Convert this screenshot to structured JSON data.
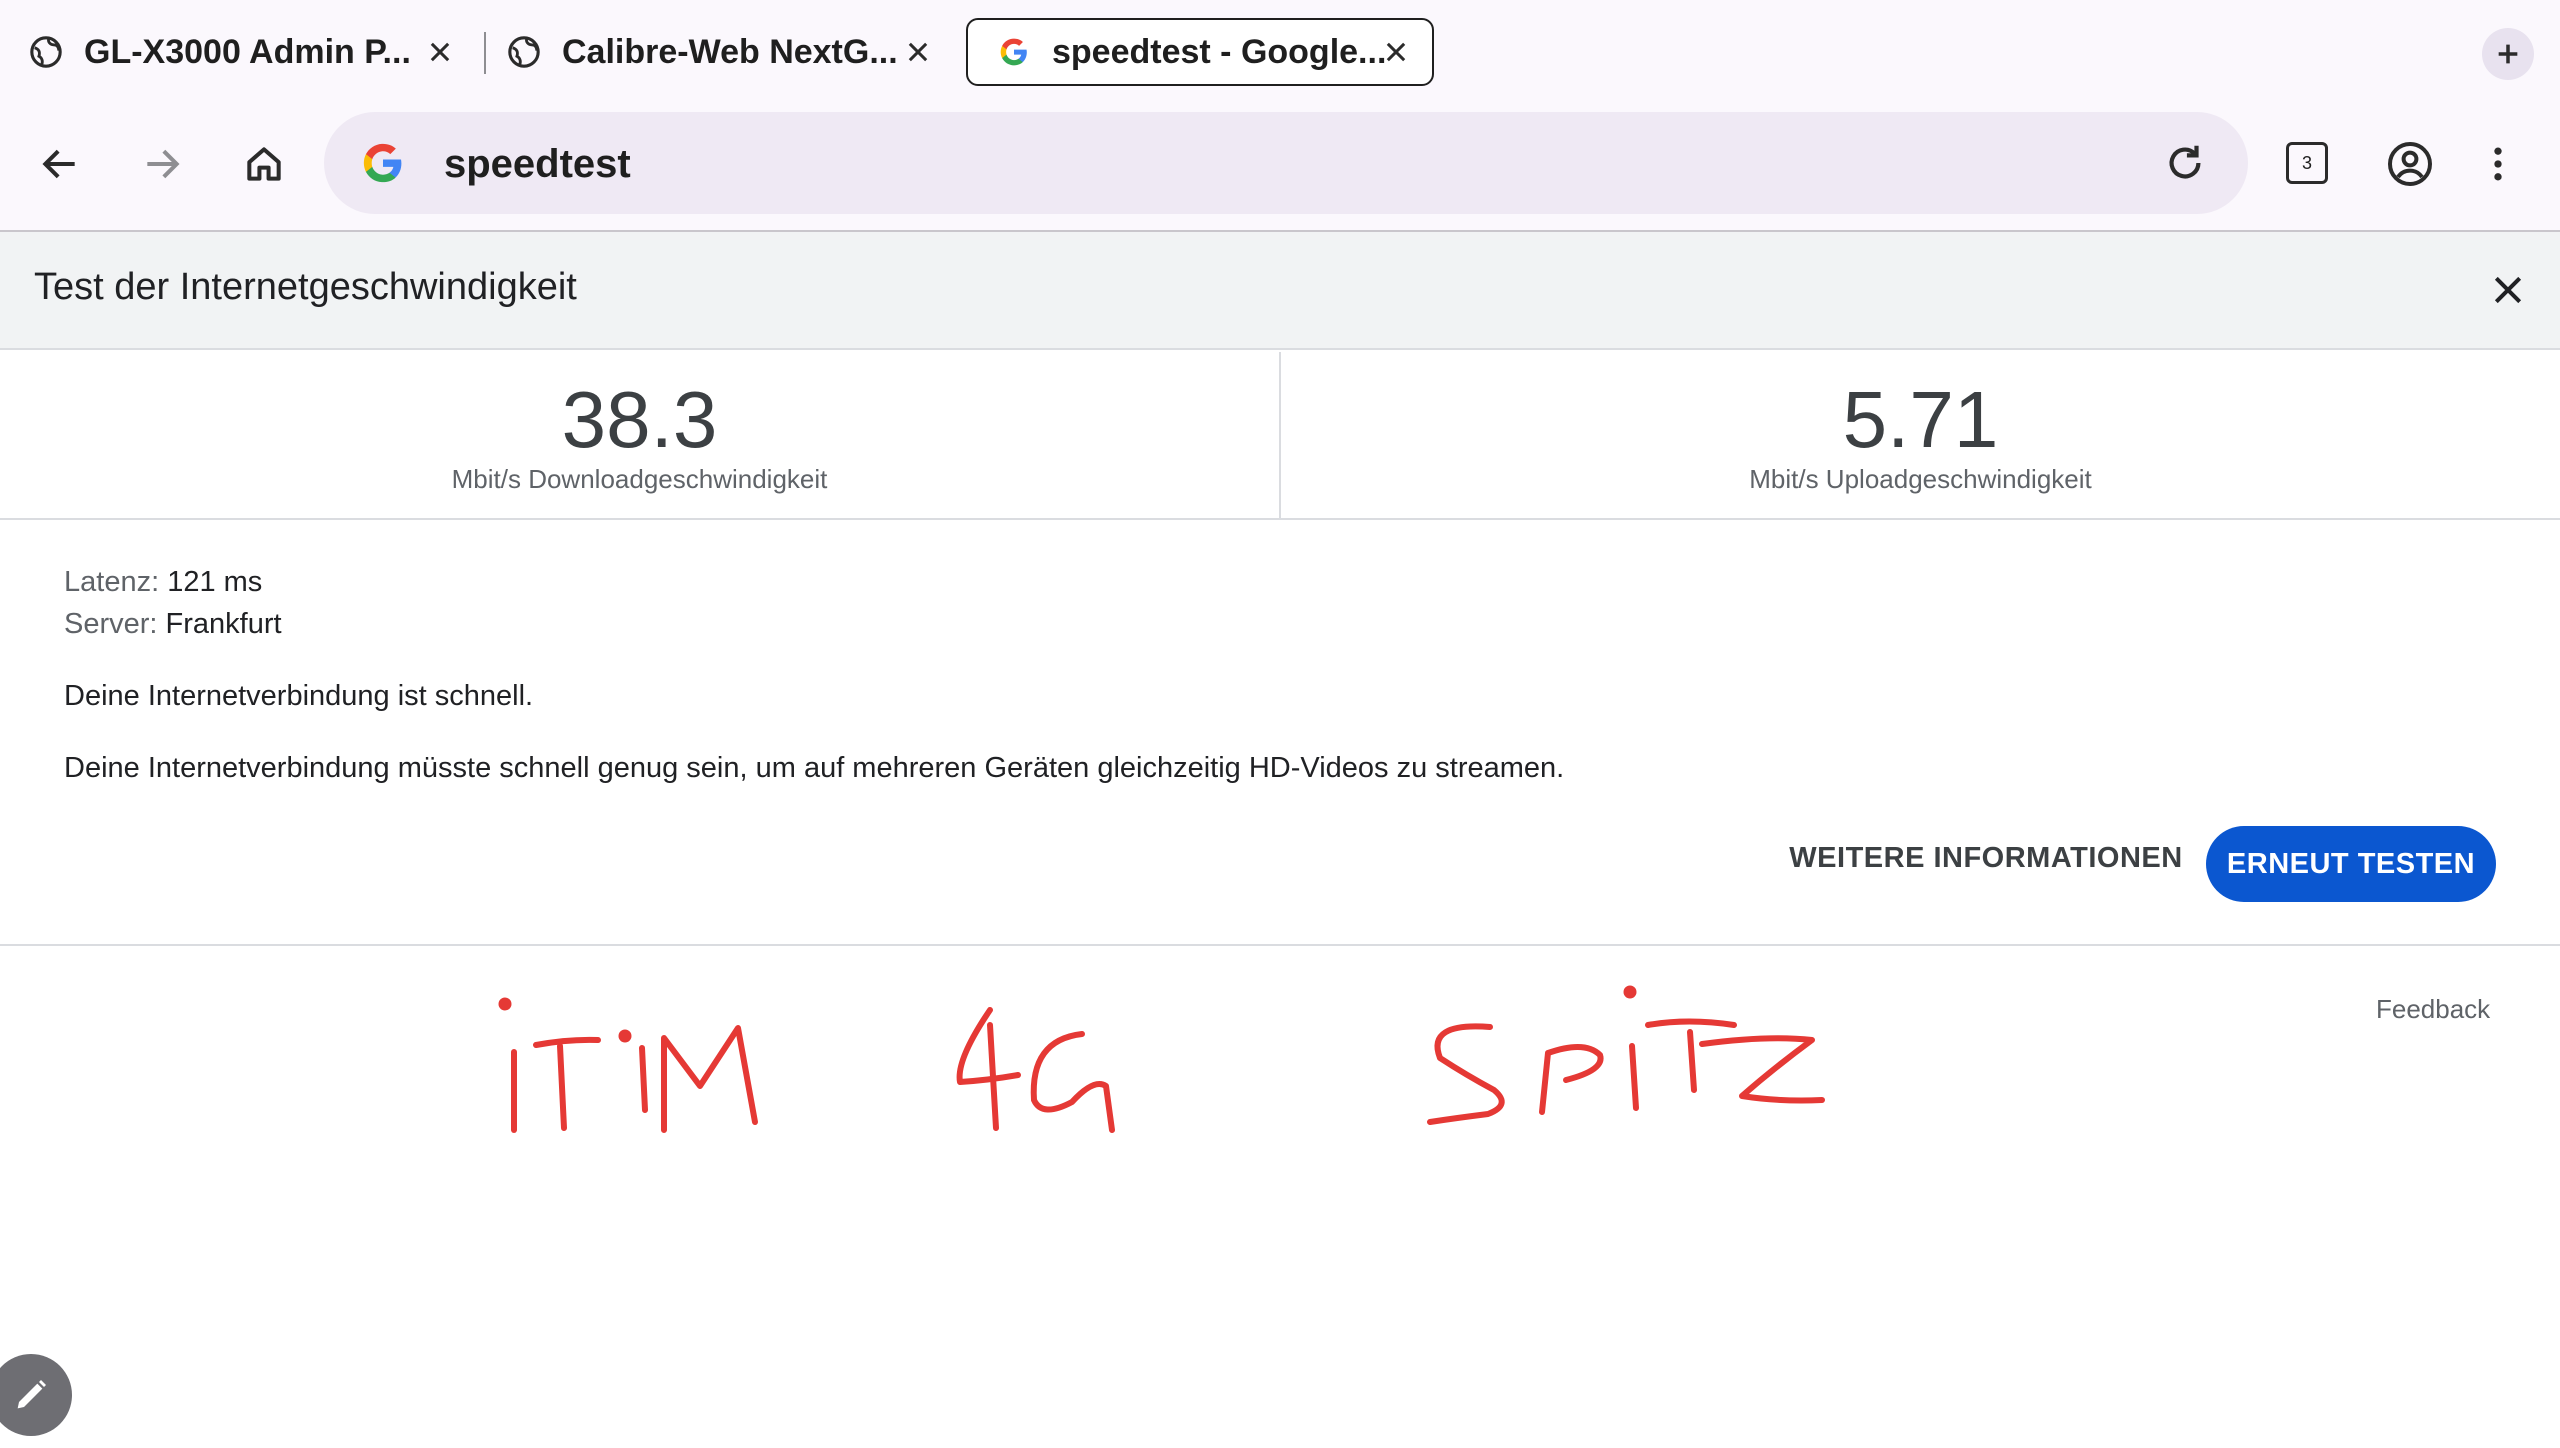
{
  "tabs": [
    {
      "title": "GL-X3000 Admin P...",
      "icon": "globe-icon"
    },
    {
      "title": "Calibre-Web NextG...",
      "icon": "globe-icon"
    },
    {
      "title": "speedtest - Google...",
      "icon": "google-icon",
      "active": true
    }
  ],
  "toolbar": {
    "omnibox_text": "speedtest",
    "tab_count": "3"
  },
  "speedtest": {
    "title": "Test der Internetgeschwindigkeit",
    "download": {
      "value": "38.3",
      "label": "Mbit/s Downloadgeschwindigkeit"
    },
    "upload": {
      "value": "5.71",
      "label": "Mbit/s Uploadgeschwindigkeit"
    },
    "latency_key": "Latenz:",
    "latency_value": "121 ms",
    "server_key": "Server:",
    "server_value": "Frankfurt",
    "message_1": "Deine Internetverbindung ist schnell.",
    "message_2": "Deine Internetverbindung müsste schnell genug sein, um auf mehreren Geräten gleichzeitig HD-Videos zu streamen.",
    "more_info_label": "WEITERE INFORMATIONEN",
    "retest_label": "ERNEUT TESTEN",
    "feedback_label": "Feedback"
  },
  "handwriting": [
    "iTiM",
    "4G",
    "SPiTZ"
  ],
  "colors": {
    "accent": "#0b57d0",
    "ink": "#e53935"
  }
}
